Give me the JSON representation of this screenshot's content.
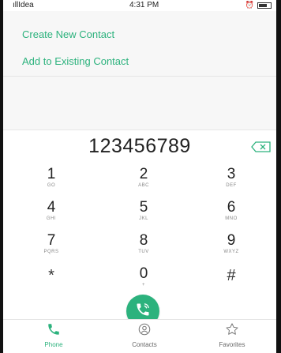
{
  "status_bar": {
    "carrier": "Idea",
    "time": "4:31 PM"
  },
  "menu": {
    "create_new_contact": "Create New Contact",
    "add_to_existing_contact": "Add to Existing Contact"
  },
  "dialer": {
    "number": "123456789"
  },
  "keypad": [
    {
      "digit": "1",
      "letters": "GO"
    },
    {
      "digit": "2",
      "letters": "ABC"
    },
    {
      "digit": "3",
      "letters": "DEF"
    },
    {
      "digit": "4",
      "letters": "GHI"
    },
    {
      "digit": "5",
      "letters": "JKL"
    },
    {
      "digit": "6",
      "letters": "MNO"
    },
    {
      "digit": "7",
      "letters": "PQRS"
    },
    {
      "digit": "8",
      "letters": "TUV"
    },
    {
      "digit": "9",
      "letters": "WXYZ"
    },
    {
      "digit": "*",
      "letters": ""
    },
    {
      "digit": "0",
      "letters": "+"
    },
    {
      "digit": "#",
      "letters": ""
    }
  ],
  "bottom_nav": {
    "phone": "Phone",
    "contacts": "Contacts",
    "favorites": "Favorites"
  },
  "colors": {
    "accent": "#2cb27d"
  },
  "icons": {
    "signal": "signal-icon",
    "alarm": "alarm-icon",
    "battery": "battery-icon",
    "backspace": "backspace-icon",
    "call": "call-icon",
    "phone": "phone-icon",
    "contacts": "contacts-icon",
    "favorites": "star-icon"
  }
}
